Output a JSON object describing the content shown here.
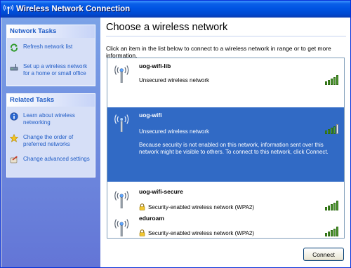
{
  "window": {
    "title": "Wireless Network Connection"
  },
  "sidebar": {
    "network_tasks": {
      "header": "Network Tasks",
      "items": [
        {
          "label": "Refresh network list",
          "icon": "refresh-icon"
        },
        {
          "label": "Set up a wireless network for a home or small office",
          "icon": "setup-wireless-icon"
        }
      ]
    },
    "related_tasks": {
      "header": "Related Tasks",
      "items": [
        {
          "label": "Learn about wireless networking",
          "icon": "info-icon"
        },
        {
          "label": "Change the order of preferred networks",
          "icon": "star-icon"
        },
        {
          "label": "Change advanced settings",
          "icon": "settings-icon"
        }
      ]
    }
  },
  "main": {
    "heading": "Choose a wireless network",
    "intro": "Click an item in the list below to connect to a wireless network in range or to get more information.",
    "networks": [
      {
        "name": "uog-wifi-lib",
        "status": "Unsecured wireless network",
        "secured": false,
        "signal_bars": 5,
        "selected": false
      },
      {
        "name": "uog-wifi",
        "status": "Unsecured wireless network",
        "secured": false,
        "signal_bars": 4,
        "selected": true,
        "detail": "Because security is not enabled on this network, information sent over this network might be visible to others. To connect to this network, click Connect."
      },
      {
        "name": "uog-wifi-secure",
        "status": "Security-enabled wireless network (WPA2)",
        "secured": true,
        "signal_bars": 5,
        "selected": false
      },
      {
        "name": "eduroam",
        "status": "Security-enabled wireless network (WPA2)",
        "secured": true,
        "signal_bars": 5,
        "selected": false
      }
    ],
    "connect_label": "Connect"
  },
  "colors": {
    "title_bar": "#0054e3",
    "selection": "#316ac5",
    "task_text": "#215dc6",
    "signal": "#4c9c2e"
  }
}
